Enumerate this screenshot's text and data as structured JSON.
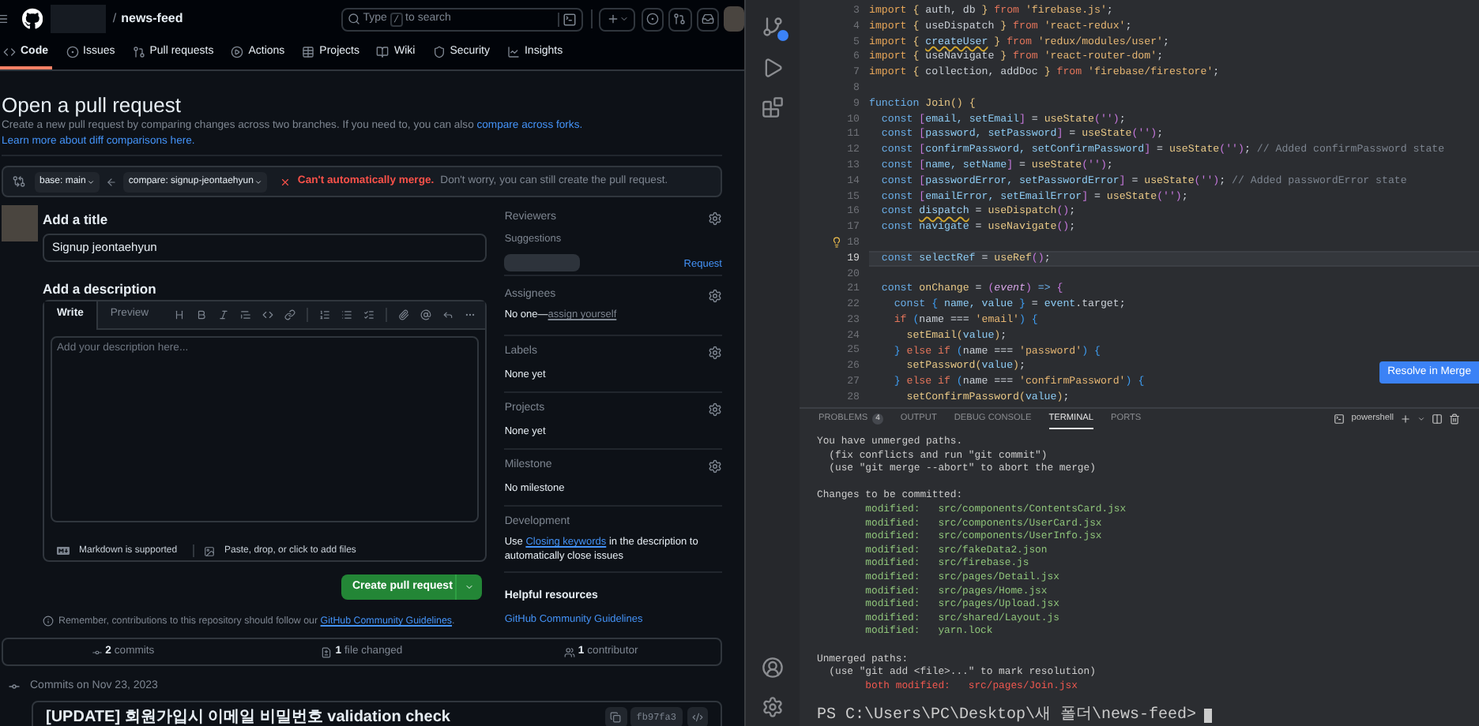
{
  "header": {
    "separator": "/",
    "repo": "news-feed",
    "search": {
      "before": "Type",
      "key": "/",
      "after": "to search"
    }
  },
  "nav_tabs": [
    {
      "label": "Code",
      "selected": true
    },
    {
      "label": "Issues",
      "selected": false
    },
    {
      "label": "Pull requests",
      "selected": false
    },
    {
      "label": "Actions",
      "selected": false
    },
    {
      "label": "Projects",
      "selected": false
    },
    {
      "label": "Wiki",
      "selected": false
    },
    {
      "label": "Security",
      "selected": false
    },
    {
      "label": "Insights",
      "selected": false
    }
  ],
  "page": {
    "title": "Open a pull request",
    "description": "Create a new pull request by comparing changes across two branches. If you need to, you can also",
    "links": [
      "compare across forks.",
      "Learn more about diff comparisons here."
    ]
  },
  "compare": {
    "base": "base: main",
    "head": "compare: signup-jeontaehyun",
    "mergeable": false,
    "status": "Can't automatically merge.",
    "note": "Don't worry, you can still create the pull request."
  },
  "form": {
    "title_label": "Add a title",
    "title_value": "Signup jeontaehyun",
    "description_label": "Add a description",
    "editor_tabs": [
      {
        "label": "Write",
        "selected": true
      },
      {
        "label": "Preview",
        "selected": false
      }
    ],
    "placeholder": "Add your description here...",
    "footer": [
      "Markdown is supported",
      "Paste, drop, or click to add files"
    ],
    "submit": "Create pull request",
    "reminder": {
      "text": "Remember, contributions to this repository should follow our",
      "link": "GitHub Community Guidelines",
      "end": "."
    }
  },
  "sidebar": [
    {
      "kind": "reviewers",
      "heading": "Reviewers",
      "sub": "Suggestions",
      "action": "Request"
    },
    {
      "kind": "assignees",
      "heading": "Assignees",
      "value": "No one—",
      "link": "assign yourself"
    },
    {
      "kind": "field",
      "heading": "Labels",
      "value": "None yet"
    },
    {
      "kind": "field",
      "heading": "Projects",
      "value": "None yet"
    },
    {
      "kind": "field",
      "heading": "Milestone",
      "value": "No milestone"
    },
    {
      "kind": "development",
      "heading": "Development",
      "before": "Use",
      "link": "Closing keywords",
      "after": "in the description to automatically close issues"
    },
    {
      "kind": "resources",
      "heading": "Helpful resources",
      "link": "GitHub Community Guidelines"
    }
  ],
  "stats": [
    {
      "count": "2",
      "label": "commits"
    },
    {
      "count": "1",
      "label": "file changed"
    },
    {
      "count": "1",
      "label": "contributor"
    }
  ],
  "commits": {
    "heading": "Commits on Nov 23, 2023",
    "items": [
      {
        "message": "[UPDATE] 회원가입시 이메일 비밀번호 validation check",
        "sha": "fb97fa3"
      }
    ]
  },
  "editor": {
    "lines": [
      {
        "number": "3",
        "kind": "plain",
        "tokens": [
          {
            "text": "import ",
            "kind": "imp"
          },
          {
            "text": "{ ",
            "kind": "br"
          },
          {
            "text": "auth, db ",
            "kind": "id"
          },
          {
            "text": "} ",
            "kind": "br"
          },
          {
            "text": "from ",
            "kind": "kw"
          },
          {
            "text": "'firebase.js'",
            "kind": "str"
          },
          {
            "text": ";",
            "kind": "id"
          }
        ]
      },
      {
        "number": "4",
        "kind": "plain",
        "tokens": [
          {
            "text": "import ",
            "kind": "imp"
          },
          {
            "text": "{ ",
            "kind": "br"
          },
          {
            "text": "useDispatch ",
            "kind": "id"
          },
          {
            "text": "} ",
            "kind": "br"
          },
          {
            "text": "from ",
            "kind": "kw"
          },
          {
            "text": "'react-redux'",
            "kind": "str"
          },
          {
            "text": ";",
            "kind": "id"
          }
        ]
      },
      {
        "number": "5",
        "kind": "plain",
        "tokens": [
          {
            "text": "import ",
            "kind": "imp"
          },
          {
            "text": "{ ",
            "kind": "br"
          },
          {
            "text": "createUser",
            "kind": "warn"
          },
          {
            "text": " } ",
            "kind": "br"
          },
          {
            "text": "from ",
            "kind": "kw"
          },
          {
            "text": "'redux/modules/user'",
            "kind": "str"
          },
          {
            "text": ";",
            "kind": "id"
          }
        ]
      },
      {
        "number": "6",
        "kind": "plain",
        "tokens": [
          {
            "text": "import ",
            "kind": "imp"
          },
          {
            "text": "{ ",
            "kind": "br"
          },
          {
            "text": "useNavigate ",
            "kind": "id"
          },
          {
            "text": "} ",
            "kind": "br"
          },
          {
            "text": "from ",
            "kind": "kw"
          },
          {
            "text": "'react-router-dom'",
            "kind": "str"
          },
          {
            "text": ";",
            "kind": "id"
          }
        ]
      },
      {
        "number": "7",
        "kind": "plain",
        "tokens": [
          {
            "text": "import ",
            "kind": "imp"
          },
          {
            "text": "{ ",
            "kind": "br"
          },
          {
            "text": "collection, addDoc ",
            "kind": "id"
          },
          {
            "text": "} ",
            "kind": "br"
          },
          {
            "text": "from ",
            "kind": "kw"
          },
          {
            "text": "'firebase/firestore'",
            "kind": "str"
          },
          {
            "text": ";",
            "kind": "id"
          }
        ]
      },
      {
        "number": "8",
        "kind": "plain"
      },
      {
        "number": "9",
        "kind": "plain",
        "tokens": [
          {
            "text": "function ",
            "kind": "decl"
          },
          {
            "text": "Join",
            "kind": "fn"
          },
          {
            "text": "() ",
            "kind": "br"
          },
          {
            "text": "{",
            "kind": "br"
          }
        ]
      },
      {
        "number": "10",
        "kind": "plain",
        "tokens": [
          {
            "text": "  const ",
            "kind": "decl"
          },
          {
            "text": "[",
            "kind": "br2"
          },
          {
            "text": "email, setEmail",
            "kind": "var"
          },
          {
            "text": "]",
            "kind": "br2"
          },
          {
            "text": " = ",
            "kind": "id"
          },
          {
            "text": "useState",
            "kind": "fn"
          },
          {
            "text": "('')",
            "kind": "br2"
          },
          {
            "text": ";",
            "kind": "id"
          }
        ]
      },
      {
        "number": "11",
        "kind": "plain",
        "tokens": [
          {
            "text": "  const ",
            "kind": "decl"
          },
          {
            "text": "[",
            "kind": "br2"
          },
          {
            "text": "password, setPassword",
            "kind": "var"
          },
          {
            "text": "]",
            "kind": "br2"
          },
          {
            "text": " = ",
            "kind": "id"
          },
          {
            "text": "useState",
            "kind": "fn"
          },
          {
            "text": "('')",
            "kind": "br2"
          },
          {
            "text": ";",
            "kind": "id"
          }
        ]
      },
      {
        "number": "12",
        "kind": "plain",
        "tokens": [
          {
            "text": "  const ",
            "kind": "decl"
          },
          {
            "text": "[",
            "kind": "br2"
          },
          {
            "text": "confirmPassword, setConfirmPassword",
            "kind": "var"
          },
          {
            "text": "]",
            "kind": "br2"
          },
          {
            "text": " = ",
            "kind": "id"
          },
          {
            "text": "useState",
            "kind": "fn"
          },
          {
            "text": "('')",
            "kind": "br2"
          },
          {
            "text": ";",
            "kind": "id"
          },
          {
            "text": " // Added confirmPassword state",
            "kind": "cmt"
          }
        ]
      },
      {
        "number": "13",
        "kind": "plain",
        "tokens": [
          {
            "text": "  const ",
            "kind": "decl"
          },
          {
            "text": "[",
            "kind": "br2"
          },
          {
            "text": "name, setName",
            "kind": "var"
          },
          {
            "text": "]",
            "kind": "br2"
          },
          {
            "text": " = ",
            "kind": "id"
          },
          {
            "text": "useState",
            "kind": "fn"
          },
          {
            "text": "('')",
            "kind": "br2"
          },
          {
            "text": ";",
            "kind": "id"
          }
        ]
      },
      {
        "number": "14",
        "kind": "plain",
        "tokens": [
          {
            "text": "  const ",
            "kind": "decl"
          },
          {
            "text": "[",
            "kind": "br2"
          },
          {
            "text": "passwordError, setPasswordError",
            "kind": "var"
          },
          {
            "text": "]",
            "kind": "br2"
          },
          {
            "text": " = ",
            "kind": "id"
          },
          {
            "text": "useState",
            "kind": "fn"
          },
          {
            "text": "('')",
            "kind": "br2"
          },
          {
            "text": ";",
            "kind": "id"
          },
          {
            "text": " // Added passwordError state",
            "kind": "cmt"
          }
        ]
      },
      {
        "number": "15",
        "kind": "plain",
        "tokens": [
          {
            "text": "  const ",
            "kind": "decl"
          },
          {
            "text": "[",
            "kind": "br2"
          },
          {
            "text": "emailError, setEmailError",
            "kind": "var"
          },
          {
            "text": "]",
            "kind": "br2"
          },
          {
            "text": " = ",
            "kind": "id"
          },
          {
            "text": "useState",
            "kind": "fn"
          },
          {
            "text": "('')",
            "kind": "br2"
          },
          {
            "text": ";",
            "kind": "id"
          }
        ]
      },
      {
        "number": "16",
        "kind": "plain",
        "tokens": [
          {
            "text": "  const ",
            "kind": "decl"
          },
          {
            "text": "dispatch",
            "kind": "warn"
          },
          {
            "text": " = ",
            "kind": "id"
          },
          {
            "text": "useDispatch",
            "kind": "fn"
          },
          {
            "text": "()",
            "kind": "br2"
          },
          {
            "text": ";",
            "kind": "id"
          }
        ]
      },
      {
        "number": "17",
        "kind": "plain",
        "tokens": [
          {
            "text": "  const ",
            "kind": "decl"
          },
          {
            "text": "navigate",
            "kind": "var"
          },
          {
            "text": " = ",
            "kind": "id"
          },
          {
            "text": "useNavigate",
            "kind": "fn"
          },
          {
            "text": "()",
            "kind": "br2"
          },
          {
            "text": ";",
            "kind": "id"
          }
        ]
      },
      {
        "number": "18",
        "kind": "bulb"
      },
      {
        "number": "19",
        "kind": "current",
        "tokens": [
          {
            "text": "  const ",
            "kind": "decl"
          },
          {
            "text": "selectRef",
            "kind": "var"
          },
          {
            "text": " = ",
            "kind": "id"
          },
          {
            "text": "useRef",
            "kind": "fn"
          },
          {
            "text": "()",
            "kind": "br2"
          },
          {
            "text": ";",
            "kind": "id"
          }
        ]
      },
      {
        "number": "20",
        "kind": "plain"
      },
      {
        "number": "21",
        "kind": "plain",
        "tokens": [
          {
            "text": "  const ",
            "kind": "decl"
          },
          {
            "text": "onChange",
            "kind": "fn"
          },
          {
            "text": " = ",
            "kind": "id"
          },
          {
            "text": "(",
            "kind": "br2"
          },
          {
            "text": "event",
            "kind": "param"
          },
          {
            "text": ")",
            "kind": "br2"
          },
          {
            "text": " => ",
            "kind": "decl"
          },
          {
            "text": "{",
            "kind": "br2"
          }
        ]
      },
      {
        "number": "22",
        "kind": "plain",
        "tokens": [
          {
            "text": "    const ",
            "kind": "decl"
          },
          {
            "text": "{ ",
            "kind": "br3"
          },
          {
            "text": "name, value ",
            "kind": "var"
          },
          {
            "text": "} ",
            "kind": "br3"
          },
          {
            "text": "= ",
            "kind": "id"
          },
          {
            "text": "event",
            "kind": "var"
          },
          {
            "text": ".target;",
            "kind": "id"
          }
        ]
      },
      {
        "number": "23",
        "kind": "plain",
        "tokens": [
          {
            "text": "    if ",
            "kind": "kw"
          },
          {
            "text": "(",
            "kind": "br3"
          },
          {
            "text": "name === ",
            "kind": "id"
          },
          {
            "text": "'email'",
            "kind": "str"
          },
          {
            "text": ") ",
            "kind": "br3"
          },
          {
            "text": "{",
            "kind": "br3"
          }
        ]
      },
      {
        "number": "24",
        "kind": "plain",
        "tokens": [
          {
            "text": "      setEmail",
            "kind": "fn"
          },
          {
            "text": "(",
            "kind": "br"
          },
          {
            "text": "value",
            "kind": "var"
          },
          {
            "text": ")",
            "kind": "br"
          },
          {
            "text": ";",
            "kind": "id"
          }
        ]
      },
      {
        "number": "25",
        "kind": "plain",
        "tokens": [
          {
            "text": "    } ",
            "kind": "br3"
          },
          {
            "text": "else if ",
            "kind": "kw"
          },
          {
            "text": "(",
            "kind": "br3"
          },
          {
            "text": "name === ",
            "kind": "id"
          },
          {
            "text": "'password'",
            "kind": "str"
          },
          {
            "text": ") ",
            "kind": "br3"
          },
          {
            "text": "{",
            "kind": "br3"
          }
        ]
      },
      {
        "number": "26",
        "kind": "plain",
        "tokens": [
          {
            "text": "      setPassword",
            "kind": "fn"
          },
          {
            "text": "(",
            "kind": "br"
          },
          {
            "text": "value",
            "kind": "var"
          },
          {
            "text": ")",
            "kind": "br"
          },
          {
            "text": ";",
            "kind": "id"
          }
        ]
      },
      {
        "number": "27",
        "kind": "plain",
        "tokens": [
          {
            "text": "    } ",
            "kind": "br3"
          },
          {
            "text": "else if ",
            "kind": "kw"
          },
          {
            "text": "(",
            "kind": "br3"
          },
          {
            "text": "name === ",
            "kind": "id"
          },
          {
            "text": "'confirmPassword'",
            "kind": "str"
          },
          {
            "text": ") ",
            "kind": "br3"
          },
          {
            "text": "{",
            "kind": "br3"
          }
        ]
      },
      {
        "number": "28",
        "kind": "plain",
        "tokens": [
          {
            "text": "      setConfirmPassword",
            "kind": "fn"
          },
          {
            "text": "(",
            "kind": "br"
          },
          {
            "text": "value",
            "kind": "var"
          },
          {
            "text": ")",
            "kind": "br"
          },
          {
            "text": ";",
            "kind": "id"
          }
        ]
      }
    ],
    "merge_button": "Resolve in Merge"
  },
  "panel_tabs": [
    {
      "label": "PROBLEMS",
      "count": "4",
      "selected": false
    },
    {
      "label": "OUTPUT",
      "selected": false
    },
    {
      "label": "DEBUG CONSOLE",
      "selected": false
    },
    {
      "label": "TERMINAL",
      "selected": true
    },
    {
      "label": "PORTS",
      "selected": false
    }
  ],
  "shell": "powershell",
  "terminal": {
    "blocks": [
      {
        "lines": [
          {
            "kind": "text",
            "text": "You have unmerged paths."
          },
          {
            "kind": "text",
            "text": "  (fix conflicts and run \"git commit\")"
          },
          {
            "kind": "text",
            "text": "  (use \"git merge --abort\" to abort the merge)"
          }
        ]
      },
      {
        "lines": [
          {
            "kind": "text",
            "text": "Changes to be committed:"
          },
          {
            "kind": "added",
            "text": "        modified:   src/components/ContentsCard.jsx"
          },
          {
            "kind": "added",
            "text": "        modified:   src/components/UserCard.jsx"
          },
          {
            "kind": "added",
            "text": "        modified:   src/components/UserInfo.jsx"
          },
          {
            "kind": "added",
            "text": "        modified:   src/fakeData2.json"
          },
          {
            "kind": "added",
            "text": "        modified:   src/firebase.js"
          },
          {
            "kind": "added",
            "text": "        modified:   src/pages/Detail.jsx"
          },
          {
            "kind": "added",
            "text": "        modified:   src/pages/Home.jsx"
          },
          {
            "kind": "added",
            "text": "        modified:   src/pages/Upload.jsx"
          },
          {
            "kind": "added",
            "text": "        modified:   src/shared/Layout.js"
          },
          {
            "kind": "added",
            "text": "        modified:   yarn.lock"
          }
        ]
      },
      {
        "lines": [
          {
            "kind": "text",
            "text": "Unmerged paths:"
          },
          {
            "kind": "text",
            "text": "  (use \"git add <file>...\" to mark resolution)"
          },
          {
            "kind": "conflict",
            "text": "        both modified:   src/pages/Join.jsx"
          }
        ]
      },
      {
        "lines": [
          {
            "kind": "prompt",
            "text": "PS C:\\Users\\PC\\Desktop\\새 폴더\\news-feed>"
          }
        ]
      }
    ]
  }
}
